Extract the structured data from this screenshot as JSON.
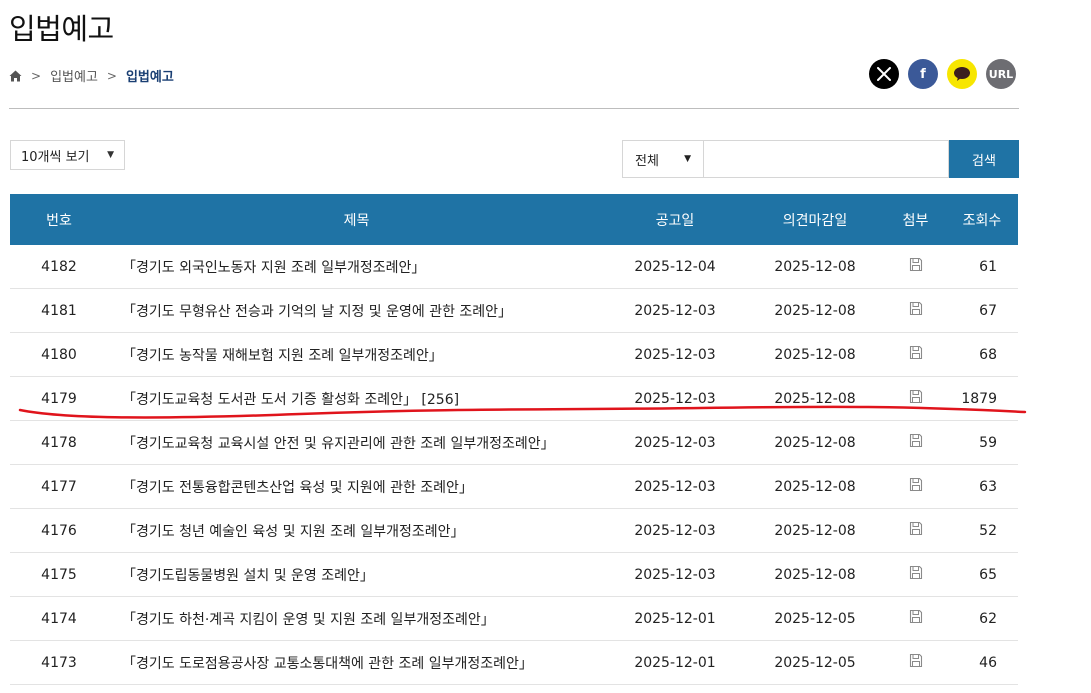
{
  "header": {
    "title": "입법예고"
  },
  "breadcrumb": {
    "home_icon": "home-icon",
    "items": [
      "입법예고",
      "입법예고"
    ]
  },
  "share": {
    "buttons": [
      {
        "name": "x-share",
        "icon": "x-logo-icon",
        "label": ""
      },
      {
        "name": "facebook-share",
        "icon": "facebook-icon",
        "label": "f"
      },
      {
        "name": "kakao-share",
        "icon": "kakao-talk-icon",
        "label": ""
      },
      {
        "name": "url-copy",
        "icon": "link-icon",
        "label": "URL"
      }
    ]
  },
  "controls": {
    "page_size": "10개씩 보기",
    "search_scope": "전체",
    "search_value": "",
    "search_button": "검색"
  },
  "table": {
    "columns": [
      "번호",
      "제목",
      "공고일",
      "의견마감일",
      "첨부",
      "조회수"
    ],
    "rows": [
      {
        "no": "4182",
        "title": "「경기도 외국인노동자 지원 조례 일부개정조례안」",
        "date": "2025-12-04",
        "deadline": "2025-12-08",
        "views": "61"
      },
      {
        "no": "4181",
        "title": "「경기도 무형유산 전승과 기억의 날 지정 및 운영에 관한 조례안」",
        "date": "2025-12-03",
        "deadline": "2025-12-08",
        "views": "67"
      },
      {
        "no": "4180",
        "title": "「경기도 농작물 재해보험 지원 조례 일부개정조례안」",
        "date": "2025-12-03",
        "deadline": "2025-12-08",
        "views": "68"
      },
      {
        "no": "4179",
        "title": "「경기도교육청 도서관 도서 기증 활성화 조례안」 [256]",
        "date": "2025-12-03",
        "deadline": "2025-12-08",
        "views": "1879"
      },
      {
        "no": "4178",
        "title": "「경기도교육청 교육시설 안전 및 유지관리에 관한 조례 일부개정조례안」",
        "date": "2025-12-03",
        "deadline": "2025-12-08",
        "views": "59"
      },
      {
        "no": "4177",
        "title": "「경기도 전통융합콘텐츠산업 육성 및 지원에 관한 조례안」",
        "date": "2025-12-03",
        "deadline": "2025-12-08",
        "views": "63"
      },
      {
        "no": "4176",
        "title": "「경기도 청년 예술인 육성 및 지원 조례 일부개정조례안」",
        "date": "2025-12-03",
        "deadline": "2025-12-08",
        "views": "52"
      },
      {
        "no": "4175",
        "title": "「경기도립동물병원 설치 및 운영 조례안」",
        "date": "2025-12-03",
        "deadline": "2025-12-08",
        "views": "65"
      },
      {
        "no": "4174",
        "title": "「경기도 하천·계곡 지킴이 운영 및 지원 조례 일부개정조례안」",
        "date": "2025-12-01",
        "deadline": "2025-12-05",
        "views": "62"
      },
      {
        "no": "4173",
        "title": "「경기도 도로점용공사장 교통소통대책에 관한 조례 일부개정조례안」",
        "date": "2025-12-01",
        "deadline": "2025-12-05",
        "views": "46"
      }
    ]
  },
  "colors": {
    "header_blue": "#1f73a5",
    "breadcrumb_current": "#1a3f73",
    "annotation_red": "#e0141c"
  }
}
